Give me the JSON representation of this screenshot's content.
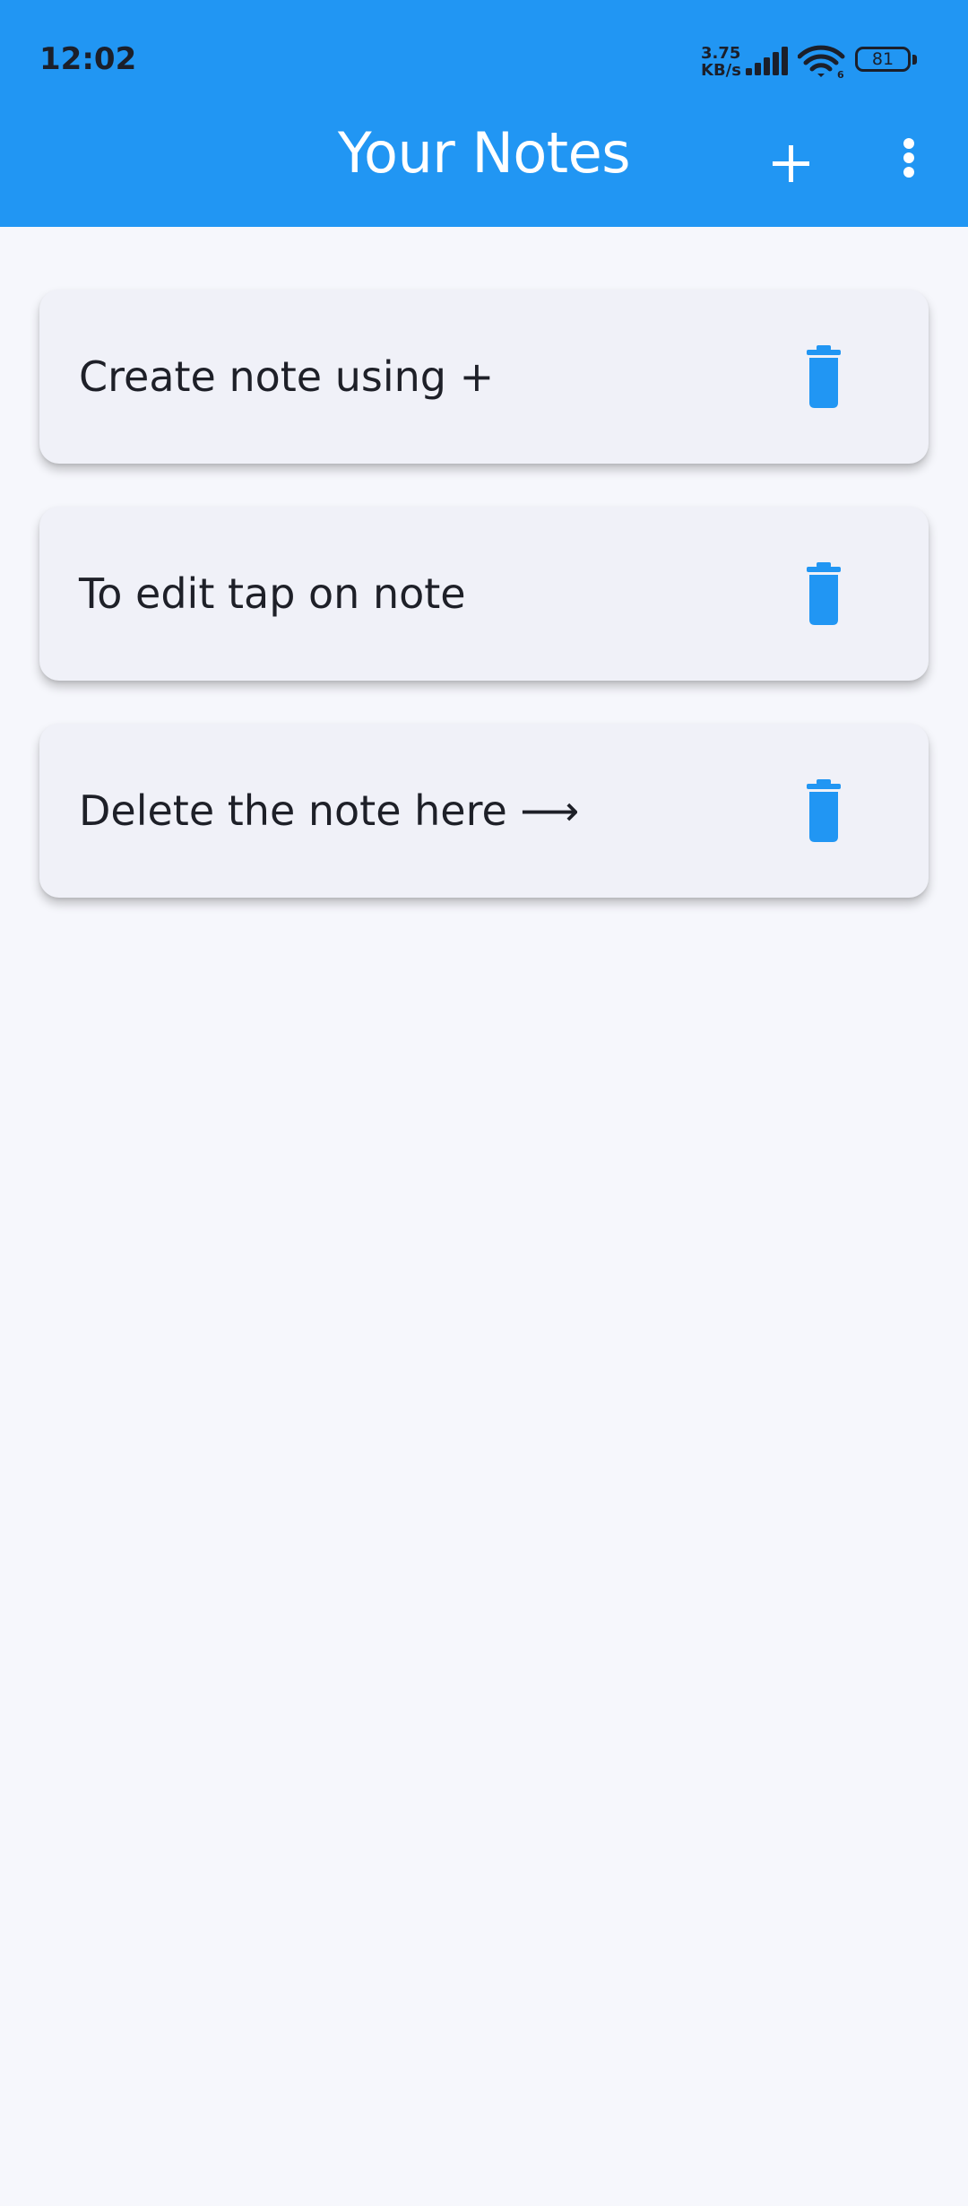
{
  "status_bar": {
    "time": "12:02",
    "net_speed_value": "3.75",
    "net_speed_unit": "KB/s",
    "wifi_label": "6",
    "battery_level": "81"
  },
  "app_bar": {
    "title": "Your Notes",
    "add_icon": "plus-icon",
    "menu_icon": "more-vertical-icon",
    "background_color": "#2196f3"
  },
  "notes": [
    {
      "title": "Create note using +",
      "delete_icon": "trash-icon"
    },
    {
      "title": "To edit tap on note",
      "delete_icon": "trash-icon"
    },
    {
      "title": "Delete the note here ⟶",
      "delete_icon": "trash-icon"
    }
  ],
  "colors": {
    "accent": "#2196f3",
    "card_background": "#f0f1f8",
    "page_background": "#f6f7fc",
    "text": "#1e2028"
  }
}
